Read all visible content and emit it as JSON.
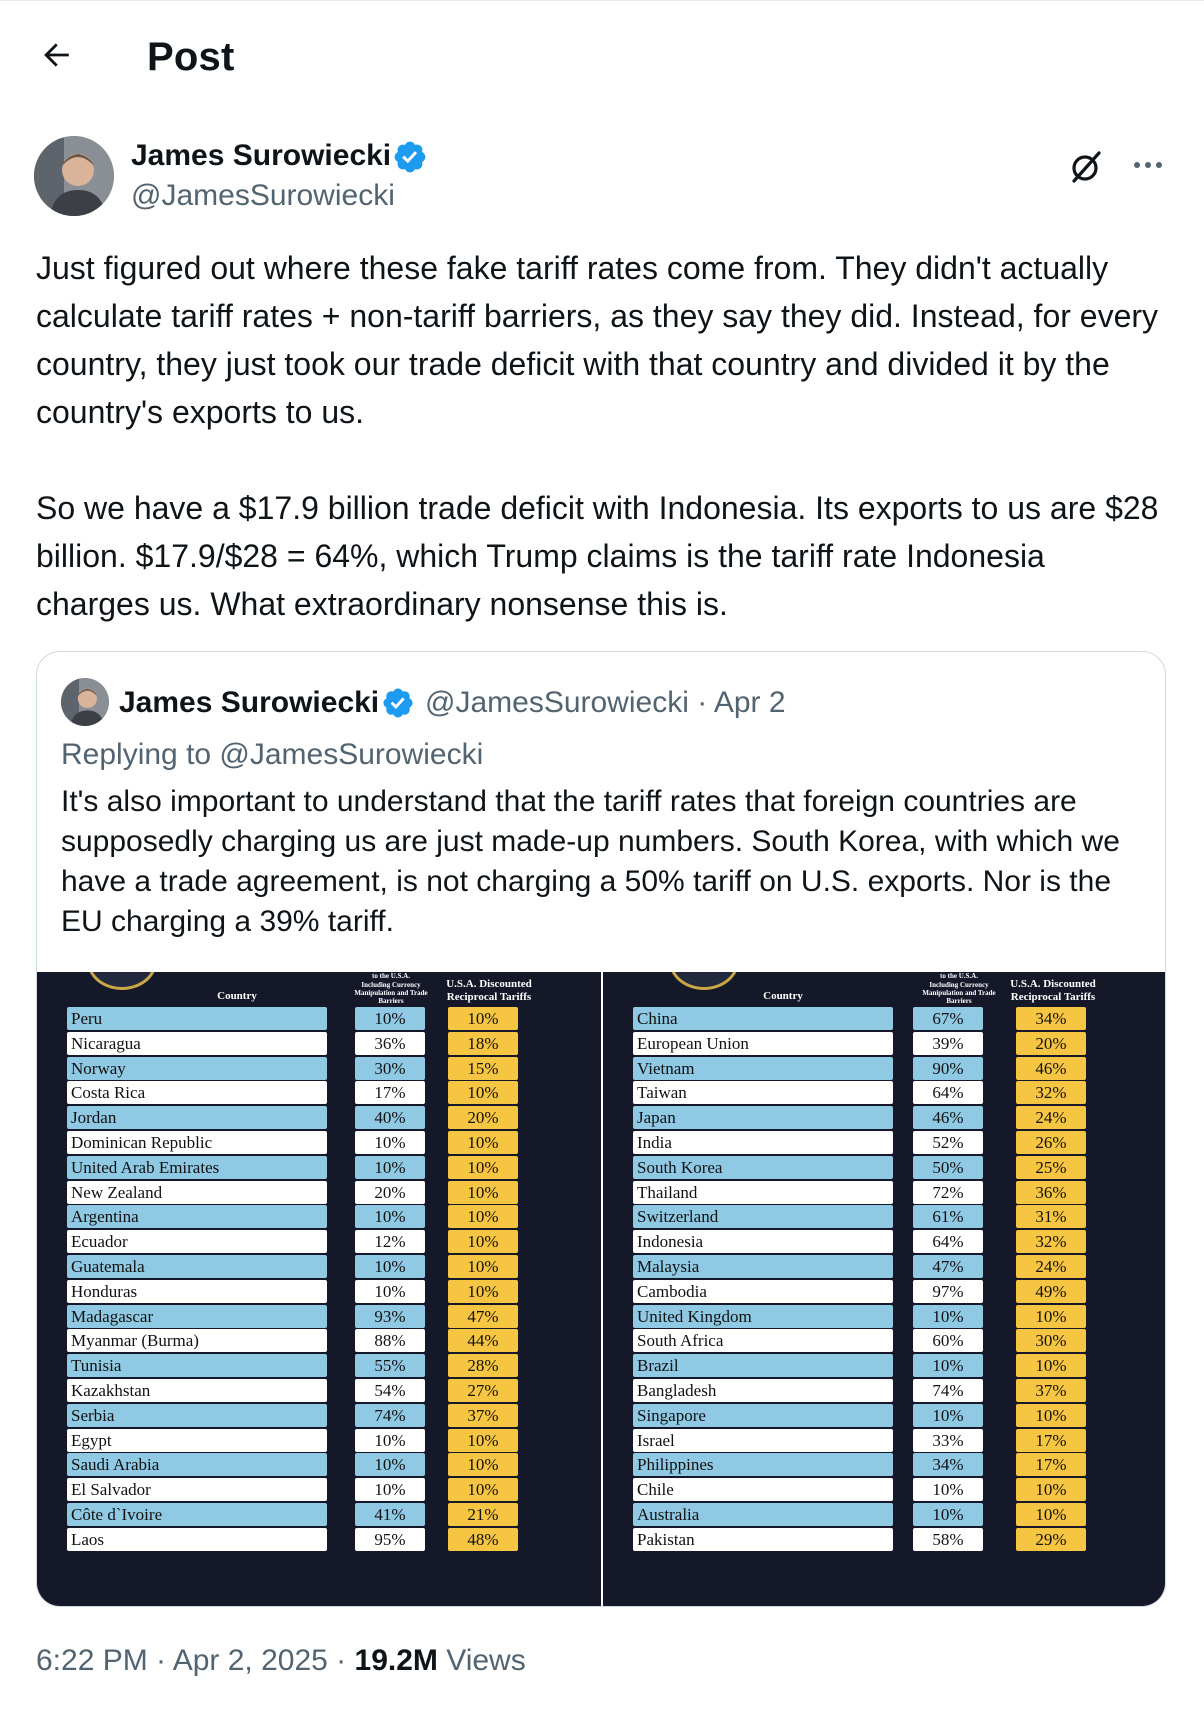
{
  "header": {
    "title": "Post",
    "back_icon": "arrow-left-icon"
  },
  "author": {
    "name": "James Surowiecki",
    "handle": "@JamesSurowiecki",
    "verified_color": "#1d9bf0"
  },
  "post": {
    "paragraphs": [
      "Just figured out where these fake tariff rates come from. They didn't actually calculate tariff rates + non-tariff barriers, as they say they did. Instead, for every country, they just took our trade deficit with that country and divided it by the country's exports to us.",
      "So we have a $17.9 billion trade deficit with Indonesia. Its exports to us are $28 billion. $17.9/$28 = 64%, which Trump claims is the tariff rate Indonesia charges us. What extraordinary nonsense this is."
    ]
  },
  "quote": {
    "name": "James Surowiecki",
    "handle_date": "@JamesSurowiecki · Apr 2",
    "replying": "Replying to @JamesSurowiecki",
    "text": "It's also important to understand that the tariff rates that foreign countries are supposedly charging us are just made-up numbers. South Korea, with which we have a trade agreement, is not charging a 50% tariff on U.S. exports. Nor is the EU charging a 39% tariff."
  },
  "table_headers": {
    "country": "Country",
    "top_fragment": "to the U.S.A.",
    "charged": "Including Currency Manipulation and Trade Barriers",
    "reciprocal_line1": "U.S.A. Discounted",
    "reciprocal_line2": "Reciprocal Tariffs"
  },
  "tables": {
    "left": [
      [
        "Peru",
        "10%",
        "10%"
      ],
      [
        "Nicaragua",
        "36%",
        "18%"
      ],
      [
        "Norway",
        "30%",
        "15%"
      ],
      [
        "Costa Rica",
        "17%",
        "10%"
      ],
      [
        "Jordan",
        "40%",
        "20%"
      ],
      [
        "Dominican Republic",
        "10%",
        "10%"
      ],
      [
        "United Arab Emirates",
        "10%",
        "10%"
      ],
      [
        "New Zealand",
        "20%",
        "10%"
      ],
      [
        "Argentina",
        "10%",
        "10%"
      ],
      [
        "Ecuador",
        "12%",
        "10%"
      ],
      [
        "Guatemala",
        "10%",
        "10%"
      ],
      [
        "Honduras",
        "10%",
        "10%"
      ],
      [
        "Madagascar",
        "93%",
        "47%"
      ],
      [
        "Myanmar (Burma)",
        "88%",
        "44%"
      ],
      [
        "Tunisia",
        "55%",
        "28%"
      ],
      [
        "Kazakhstan",
        "54%",
        "27%"
      ],
      [
        "Serbia",
        "74%",
        "37%"
      ],
      [
        "Egypt",
        "10%",
        "10%"
      ],
      [
        "Saudi Arabia",
        "10%",
        "10%"
      ],
      [
        "El Salvador",
        "10%",
        "10%"
      ],
      [
        "Côte d`Ivoire",
        "41%",
        "21%"
      ],
      [
        "Laos",
        "95%",
        "48%"
      ]
    ],
    "right": [
      [
        "China",
        "67%",
        "34%"
      ],
      [
        "European Union",
        "39%",
        "20%"
      ],
      [
        "Vietnam",
        "90%",
        "46%"
      ],
      [
        "Taiwan",
        "64%",
        "32%"
      ],
      [
        "Japan",
        "46%",
        "24%"
      ],
      [
        "India",
        "52%",
        "26%"
      ],
      [
        "South Korea",
        "50%",
        "25%"
      ],
      [
        "Thailand",
        "72%",
        "36%"
      ],
      [
        "Switzerland",
        "61%",
        "31%"
      ],
      [
        "Indonesia",
        "64%",
        "32%"
      ],
      [
        "Malaysia",
        "47%",
        "24%"
      ],
      [
        "Cambodia",
        "97%",
        "49%"
      ],
      [
        "United Kingdom",
        "10%",
        "10%"
      ],
      [
        "South Africa",
        "60%",
        "30%"
      ],
      [
        "Brazil",
        "10%",
        "10%"
      ],
      [
        "Bangladesh",
        "74%",
        "37%"
      ],
      [
        "Singapore",
        "10%",
        "10%"
      ],
      [
        "Israel",
        "33%",
        "17%"
      ],
      [
        "Philippines",
        "34%",
        "17%"
      ],
      [
        "Chile",
        "10%",
        "10%"
      ],
      [
        "Australia",
        "10%",
        "10%"
      ],
      [
        "Pakistan",
        "58%",
        "29%"
      ]
    ]
  },
  "meta": {
    "time_date": "6:22 PM · Apr 2, 2025 · ",
    "views_count": "19.2M",
    "views_label": " Views"
  },
  "colors": {
    "row_blue": "#8fc9e3",
    "row_white": "#ffffff",
    "tariff_yellow": "#f6c643",
    "table_bg": "#141829"
  }
}
